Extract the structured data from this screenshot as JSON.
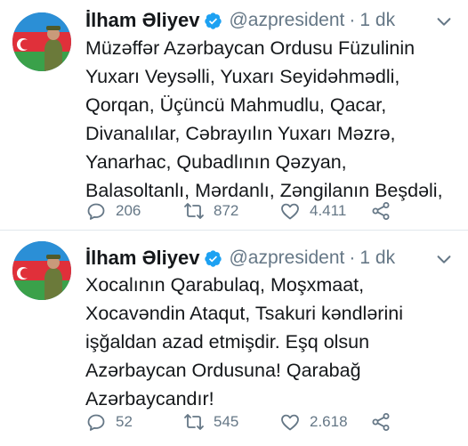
{
  "colors": {
    "verified": "#1da1f2",
    "secondary_text": "#657786",
    "primary_text": "#14171a",
    "divider": "#e1e8ed"
  },
  "tweets": [
    {
      "author_name": "İlham Əliyev",
      "handle": "@azpresident",
      "separator": "·",
      "time": "1 dk",
      "avatar_caption": "Qarabağ Azərbaycandır",
      "text": "Müzəffər Azərbaycan Ordusu Füzulinin\nYuxarı Veysəlli, Yuxarı Seyidəhmədli,\nQorqan, Üçüncü Mahmudlu, Qacar,\nDivanalılar, Cəbrayılın Yuxarı Məzrə,\nYanarhac, Qubadlının Qəzyan,\nBalasoltanlı, Mərdanlı, Zəngilanın Beşdəli,",
      "replies": "206",
      "retweets": "872",
      "likes": "4.411",
      "icons": [
        "reply-icon",
        "retweet-icon",
        "like-icon",
        "share-icon"
      ]
    },
    {
      "author_name": "İlham Əliyev",
      "handle": "@azpresident",
      "separator": "·",
      "time": "1 dk",
      "avatar_caption": "Qarabağ Azərbaycandır",
      "text": "Xocalının Qarabulaq, Moşxmaat,\nXocavəndin Ataqut, Tsakuri kəndlərini\nişğaldan azad etmişdir. Eşq olsun\nAzərbaycan Ordusuna! Qarabağ\nAzərbaycandır!",
      "replies": "52",
      "retweets": "545",
      "likes": "2.618",
      "icons": [
        "reply-icon",
        "retweet-icon",
        "like-icon",
        "share-icon"
      ]
    }
  ]
}
